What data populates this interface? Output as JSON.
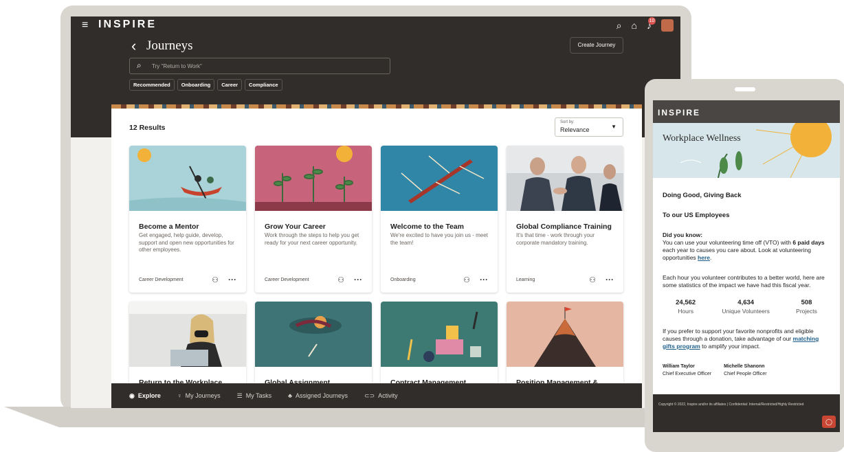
{
  "laptop": {
    "brand": "INSPIRE",
    "notification_count": "10",
    "page_title": "Journeys",
    "create_button": "Create Journey",
    "search": {
      "placeholder": "Try \"Return to Work\""
    },
    "filters": [
      "Recommended",
      "Onboarding",
      "Career",
      "Compliance"
    ],
    "results_count": "12 Results",
    "sort": {
      "label": "Sort by:",
      "value": "Relevance"
    },
    "cards": [
      {
        "title": "Become a Mentor",
        "description": "Get engaged, help guide, develop, support and open new opportunities for other employees.",
        "category": "Career Development",
        "image": "kayak-illustration"
      },
      {
        "title": "Grow Your Career",
        "description": "Work through the steps to help you get ready for your next career opportunity.",
        "category": "Career Development",
        "image": "plants-illustration"
      },
      {
        "title": "Welcome to the Team",
        "description": "We're excited to have you join us - meet the team!",
        "category": "Onboarding",
        "image": "rowing-illustration"
      },
      {
        "title": "Global Compliance Training",
        "description": "It's that time - work through your corporate mandatory training.",
        "category": "Learning",
        "image": "handshake-photo"
      },
      {
        "title": "Return to the Workplace",
        "image": "masked-worker-photo"
      },
      {
        "title": "Global Assignment",
        "image": "swimmer-illustration"
      },
      {
        "title": "Contract Management",
        "image": "blocks-illustration"
      },
      {
        "title": "Position Management &",
        "image": "mountain-illustration"
      }
    ],
    "bottom_nav": [
      "Explore",
      "My Journeys",
      "My Tasks",
      "Assigned Journeys",
      "Activity"
    ]
  },
  "tablet": {
    "brand": "INSPIRE",
    "hero_title": "Workplace Wellness",
    "heading": "Doing Good, Giving Back",
    "subheading": "To our US Employees",
    "did_you_know_title": "Did you know:",
    "did_you_know_1": "You can use your volunteering time off (VTO) with",
    "did_you_know_bold": "6 paid days",
    "did_you_know_2": "each year to causes you care about. Look at volunteering opportunities",
    "here_link": "here",
    "impact_text": "Each hour you volunteer contributes to a better world, here are some statistics of the impact we have had this fiscal year.",
    "stats": [
      {
        "value": "24,562",
        "label": "Hours"
      },
      {
        "value": "4,634",
        "label": "Unique Volunteers"
      },
      {
        "value": "508",
        "label": "Projects"
      }
    ],
    "donation_1": "If you prefer to support your favorite nonprofits and eligible causes through a donation, take advantage of our",
    "donation_link": "matching gifts program",
    "donation_2": "to amplify your impact.",
    "signatories": [
      {
        "name": "William Taylor",
        "title": "Chief Executive Officer"
      },
      {
        "name": "Michelle Shanonn",
        "title": "Chief People Officer"
      }
    ],
    "footer": "Copyright © 2022, Inspire and/or its affiliates | Confidential: Internal/Restricted/Highly Restricted"
  }
}
